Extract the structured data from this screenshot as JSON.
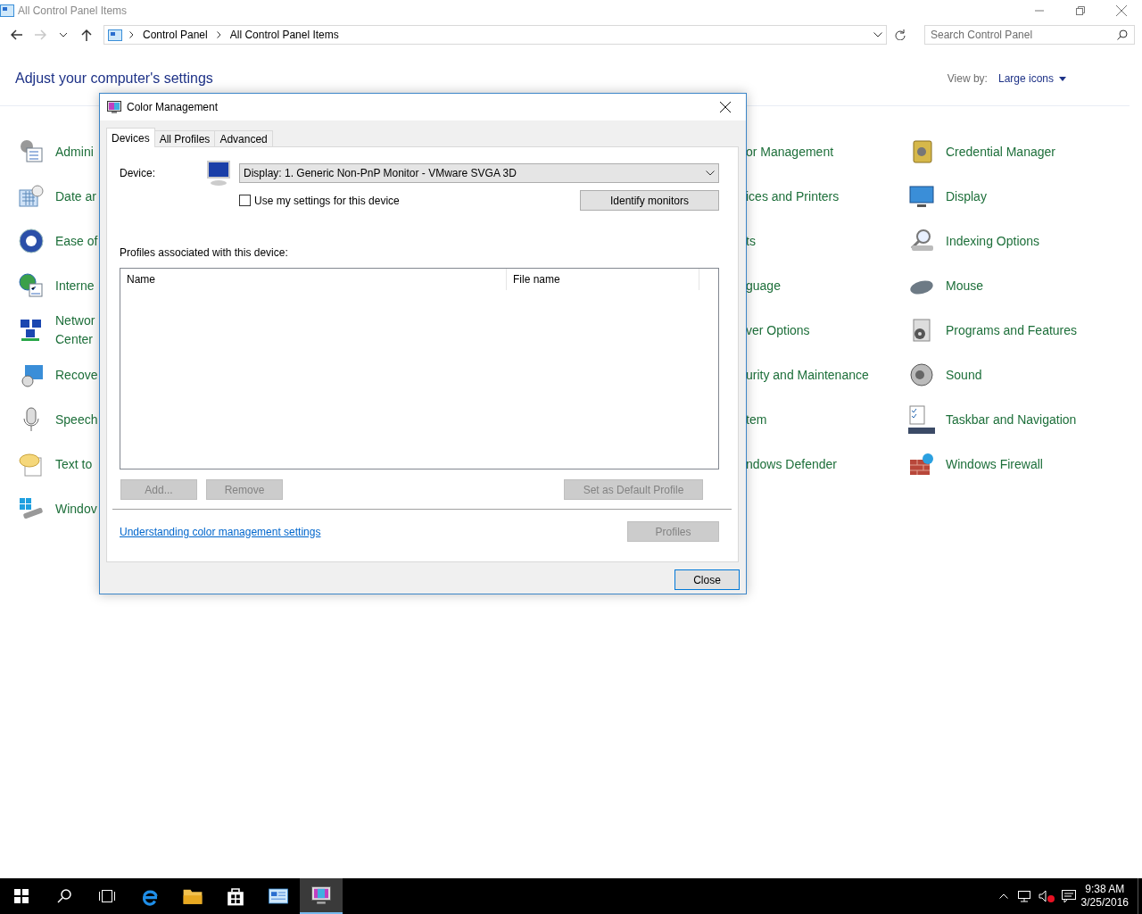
{
  "explorer": {
    "title": "All Control Panel Items",
    "nav": {
      "back": {
        "disabled": false
      },
      "forward": {
        "disabled": true
      }
    },
    "address": [
      "Control Panel",
      "All Control Panel Items"
    ],
    "search": {
      "placeholder": "Search Control Panel"
    },
    "heading": "Adjust your computer's settings",
    "view_by": {
      "label": "View by:",
      "value": "Large icons"
    },
    "columns": [
      {
        "items": [
          "Admini",
          "Date ar",
          "Ease of",
          "Interne",
          "Networ\nCenter",
          "Recove",
          "Speech",
          "Text to",
          "Windov"
        ]
      },
      {
        "items": [
          "or Management",
          "ices and Printers",
          "ts",
          "guage",
          "ver Options",
          "urity and Maintenance",
          "tem",
          "ndows Defender"
        ]
      },
      {
        "items": [
          "Credential Manager",
          "Display",
          "Indexing Options",
          "Mouse",
          "Programs and Features",
          "Sound",
          "Taskbar and Navigation",
          "Windows Firewall"
        ]
      }
    ]
  },
  "dialog": {
    "title": "Color Management",
    "tabs": [
      {
        "label": "Devices",
        "selected": true
      },
      {
        "label": "All Profiles",
        "selected": false
      },
      {
        "label": "Advanced",
        "selected": false
      }
    ],
    "device_label": "Device:",
    "device": "Display: 1. Generic Non-PnP Monitor - VMware SVGA 3D",
    "use_my_settings": {
      "label": "Use my settings for this device",
      "checked": false
    },
    "identify": {
      "label": "Identify monitors",
      "disabled": false
    },
    "profiles_label": "Profiles associated with this device:",
    "list_columns": [
      "Name",
      "File name"
    ],
    "list_buttons": [
      {
        "label": "Add...",
        "disabled": true
      },
      {
        "label": "Remove",
        "disabled": true
      },
      {
        "label": "Set as Default Profile",
        "disabled": true
      }
    ],
    "link": "Understanding color management settings",
    "profiles_button": {
      "label": "Profiles",
      "disabled": true
    },
    "close_button": "Close"
  },
  "taskbar": {
    "apps": [
      {
        "kind": "edge",
        "selected": false
      },
      {
        "kind": "explorer",
        "selected": false
      },
      {
        "kind": "store",
        "selected": false
      },
      {
        "kind": "control",
        "selected": false
      },
      {
        "kind": "color",
        "selected": true
      }
    ],
    "time": "9:38 AM",
    "date": "3/25/2016"
  }
}
